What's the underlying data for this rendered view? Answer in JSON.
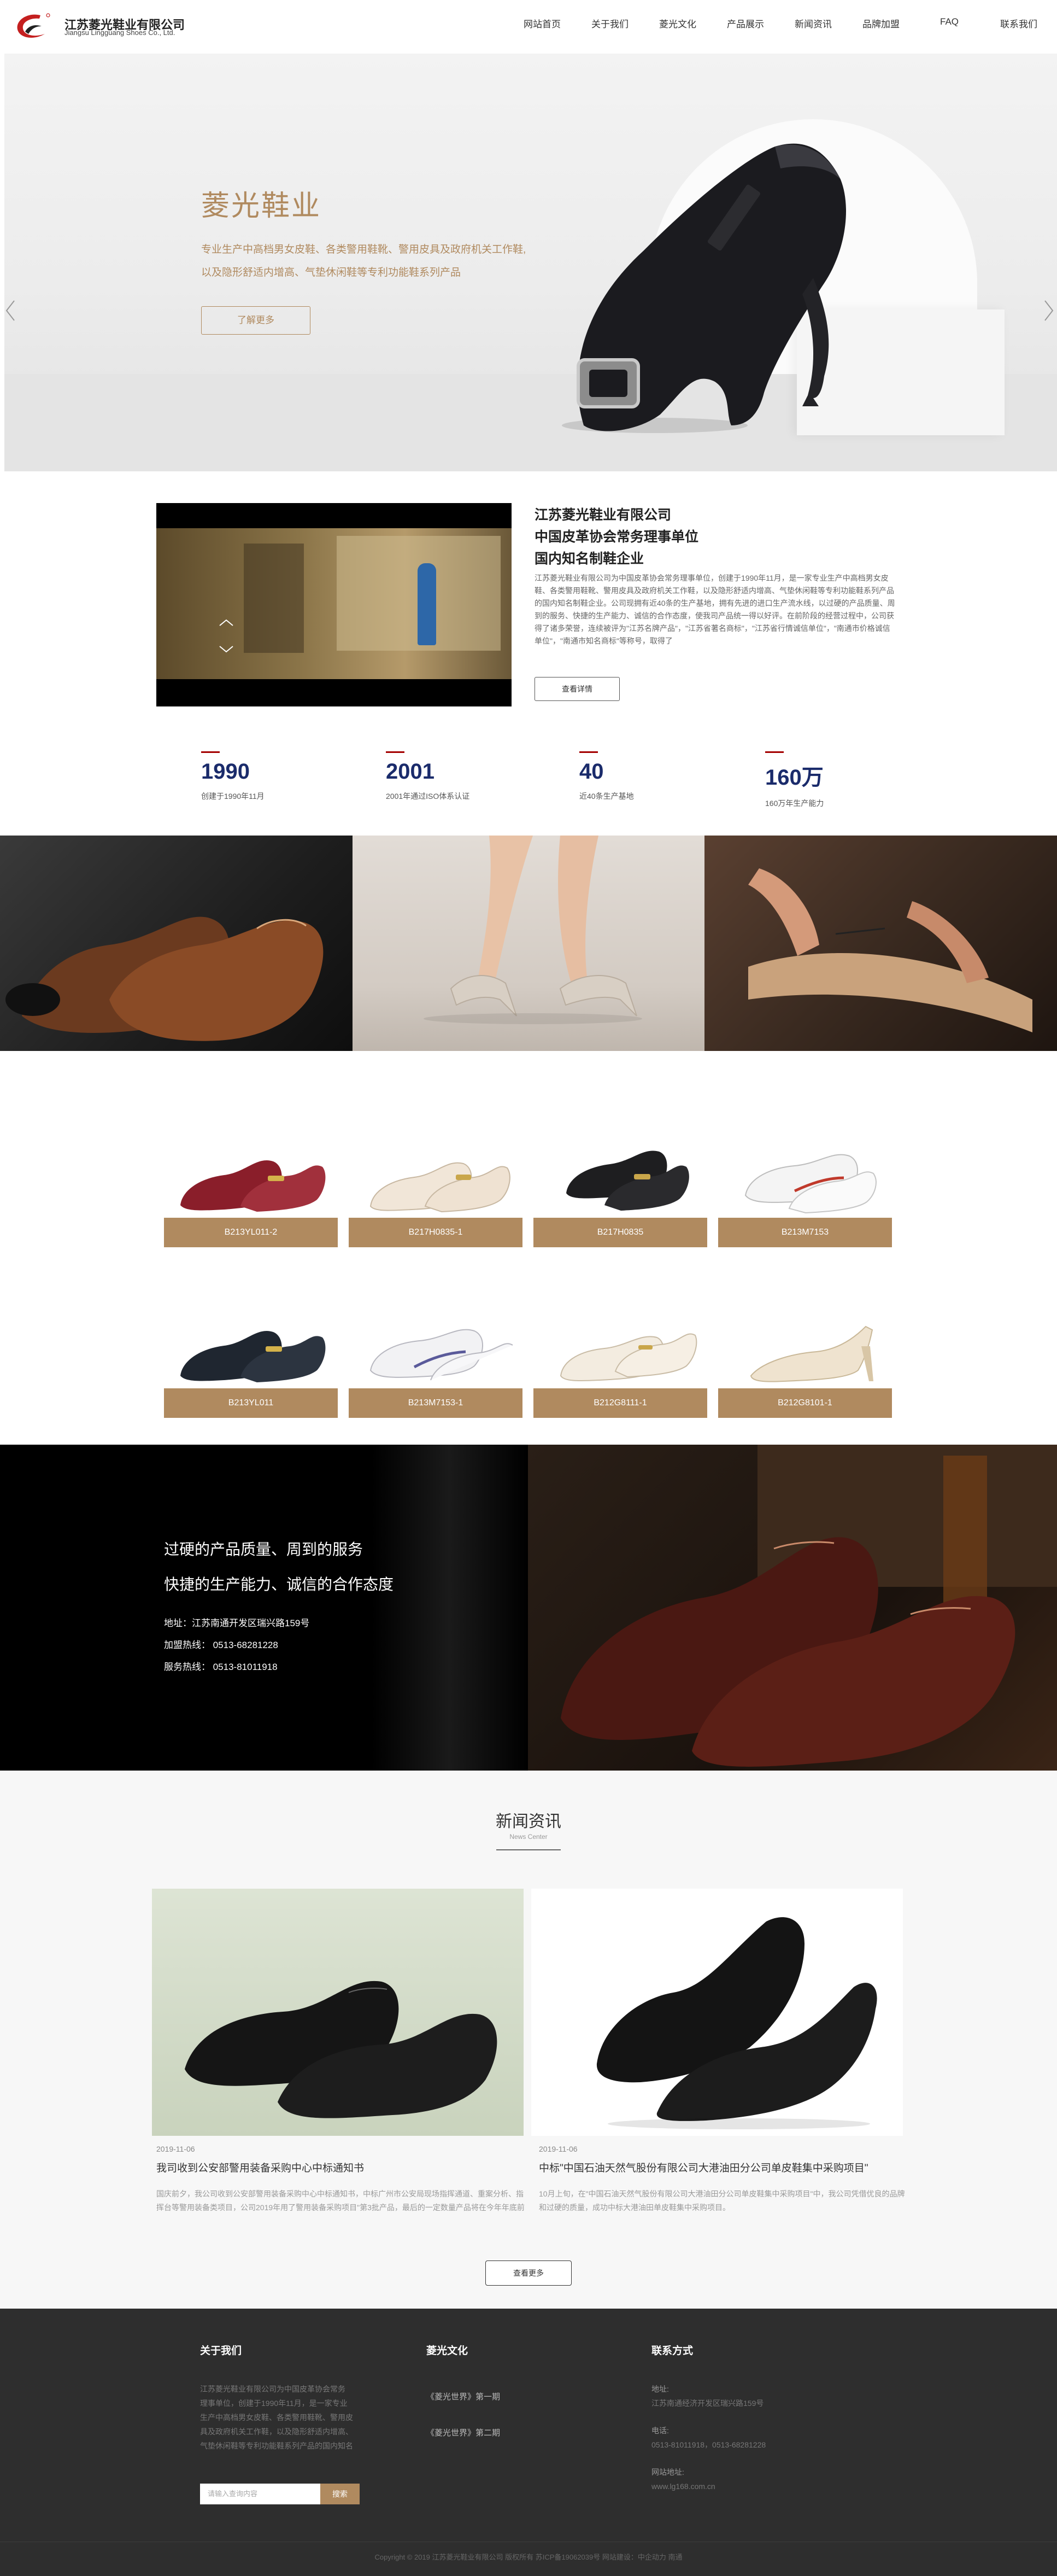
{
  "header": {
    "company_cn": "江苏菱光鞋业有限公司",
    "company_en": "Jiangsu Lingguang Shoes Co., Ltd.",
    "nav": [
      "网站首页",
      "关于我们",
      "菱光文化",
      "产品展示",
      "新闻资讯",
      "品牌加盟",
      "FAQ",
      "联系我们"
    ]
  },
  "banner": {
    "title": "菱光鞋业",
    "desc_line1": "专业生产中高档男女皮鞋、各类警用鞋靴、警用皮具及政府机关工作鞋,",
    "desc_line2": "以及隐形舒适内增高、气垫休闲鞋等专利功能鞋系列产品",
    "button": "了解更多",
    "prev_icon": "chevron-left-icon",
    "next_icon": "chevron-right-icon"
  },
  "about": {
    "title1": "江苏菱光鞋业有限公司",
    "title2": "中国皮革协会常务理事单位",
    "title3": "国内知名制鞋企业",
    "text": "江苏菱光鞋业有限公司为中国皮革协会常务理事单位，创建于1990年11月，是一家专业生产中高档男女皮鞋、各类警用鞋靴、警用皮具及政府机关工作鞋，以及隐形舒适内增高、气垫休闲鞋等专利功能鞋系列产品的国内知名制鞋企业。公司现拥有近40条的生产基地，拥有先进的进口生产流水线，以过硬的产品质量、周到的服务、快捷的生产能力、诚信的合作态度，使我司产品统一得以好评。在前阶段的经营过程中，公司获得了诸多荣誉，连续被评为\"江苏名牌产品\"，\"江苏省著名商标\"，\"江苏省行情诚信单位\"，\"南通市价格诚信单位\"，\"南通市知名商标\"等称号，取得了",
    "button": "查看详情",
    "stats": [
      {
        "num": "1990",
        "label": "创建于1990年11月"
      },
      {
        "num": "2001",
        "label": "2001年通过ISO体系认证"
      },
      {
        "num": "40",
        "label": "近40条生产基地"
      },
      {
        "num": "160万",
        "label": "160万年生产能力"
      }
    ]
  },
  "products": [
    {
      "code": "B213YL011-2"
    },
    {
      "code": "B217H0835-1"
    },
    {
      "code": "B217H0835"
    },
    {
      "code": "B213M7153"
    },
    {
      "code": "B213YL011"
    },
    {
      "code": "B213M7153-1"
    },
    {
      "code": "B212G8111-1"
    },
    {
      "code": "B212G8101-1"
    }
  ],
  "band": {
    "line1": "过硬的产品质量、周到的服务",
    "line2": "快捷的生产能力、诚信的合作态度",
    "address": "地址：江苏南通开发区瑞兴路159号",
    "franchise": "加盟热线： 0513-68281228",
    "service": "服务热线： 0513-81011918"
  },
  "news": {
    "title": "新闻资讯",
    "subtitle": "News Center",
    "items": [
      {
        "date": "2019-11-06",
        "title": "我司收到公安部警用装备采购中心中标通知书",
        "body": "国庆前夕，我公司收到公安部警用装备采购中心中标通知书，中标广州市公安局现场指挥通道、重案分析、指挥台等警用装备类项目，公司2019年用了警用装备采购项目\"第3批产品，最后的一定数量产品将在今年年底前全部交付。"
      },
      {
        "date": "2019-11-06",
        "title": "中标\"中国石油天然气股份有限公司大港油田分公司单皮鞋集中采购项目\"",
        "body": "10月上旬，在\"中国石油天然气股份有限公司大港油田分公司单皮鞋集中采购项目\"中，我公司凭借优良的品牌和过硬的质量，成功中标大港油田单皮鞋集中采购项目。"
      }
    ],
    "more": "查看更多"
  },
  "footer": {
    "about_title": "关于我们",
    "about_text": [
      "江苏菱光鞋业有限公司为中国皮革协会常务",
      "理事单位，创建于1990年11月，是一家专业",
      "生产中高档男女皮鞋、各类警用鞋靴、警用皮",
      "具及政府机关工作鞋，以及隐形舒适内增高、",
      "气垫休闲鞋等专利功能鞋系列产品的国内知名"
    ],
    "culture_title": "菱光文化",
    "culture_links": [
      "《菱光世界》第一期",
      "《菱光世界》第二期"
    ],
    "contact_title": "联系方式",
    "contact": {
      "address_label": "地址:",
      "address": "江苏南通经济开发区瑞兴路159号",
      "phone_label": "电话:",
      "phone": "0513-81011918，0513-68281228",
      "web_label": "网站地址:",
      "web": "www.lg168.com.cn"
    },
    "search_placeholder": "请输入查询内容",
    "search_button": "搜索",
    "copyright": "Copyright © 2019 江苏菱光鞋业有限公司 版权所有 苏ICP备19062039号 网站建设：中企动力 南通"
  },
  "colors": {
    "accent": "#b08a5f",
    "stat_num": "#1a2b6b",
    "stat_bar": "#a40000",
    "footer_bg": "#2e2e2e"
  }
}
